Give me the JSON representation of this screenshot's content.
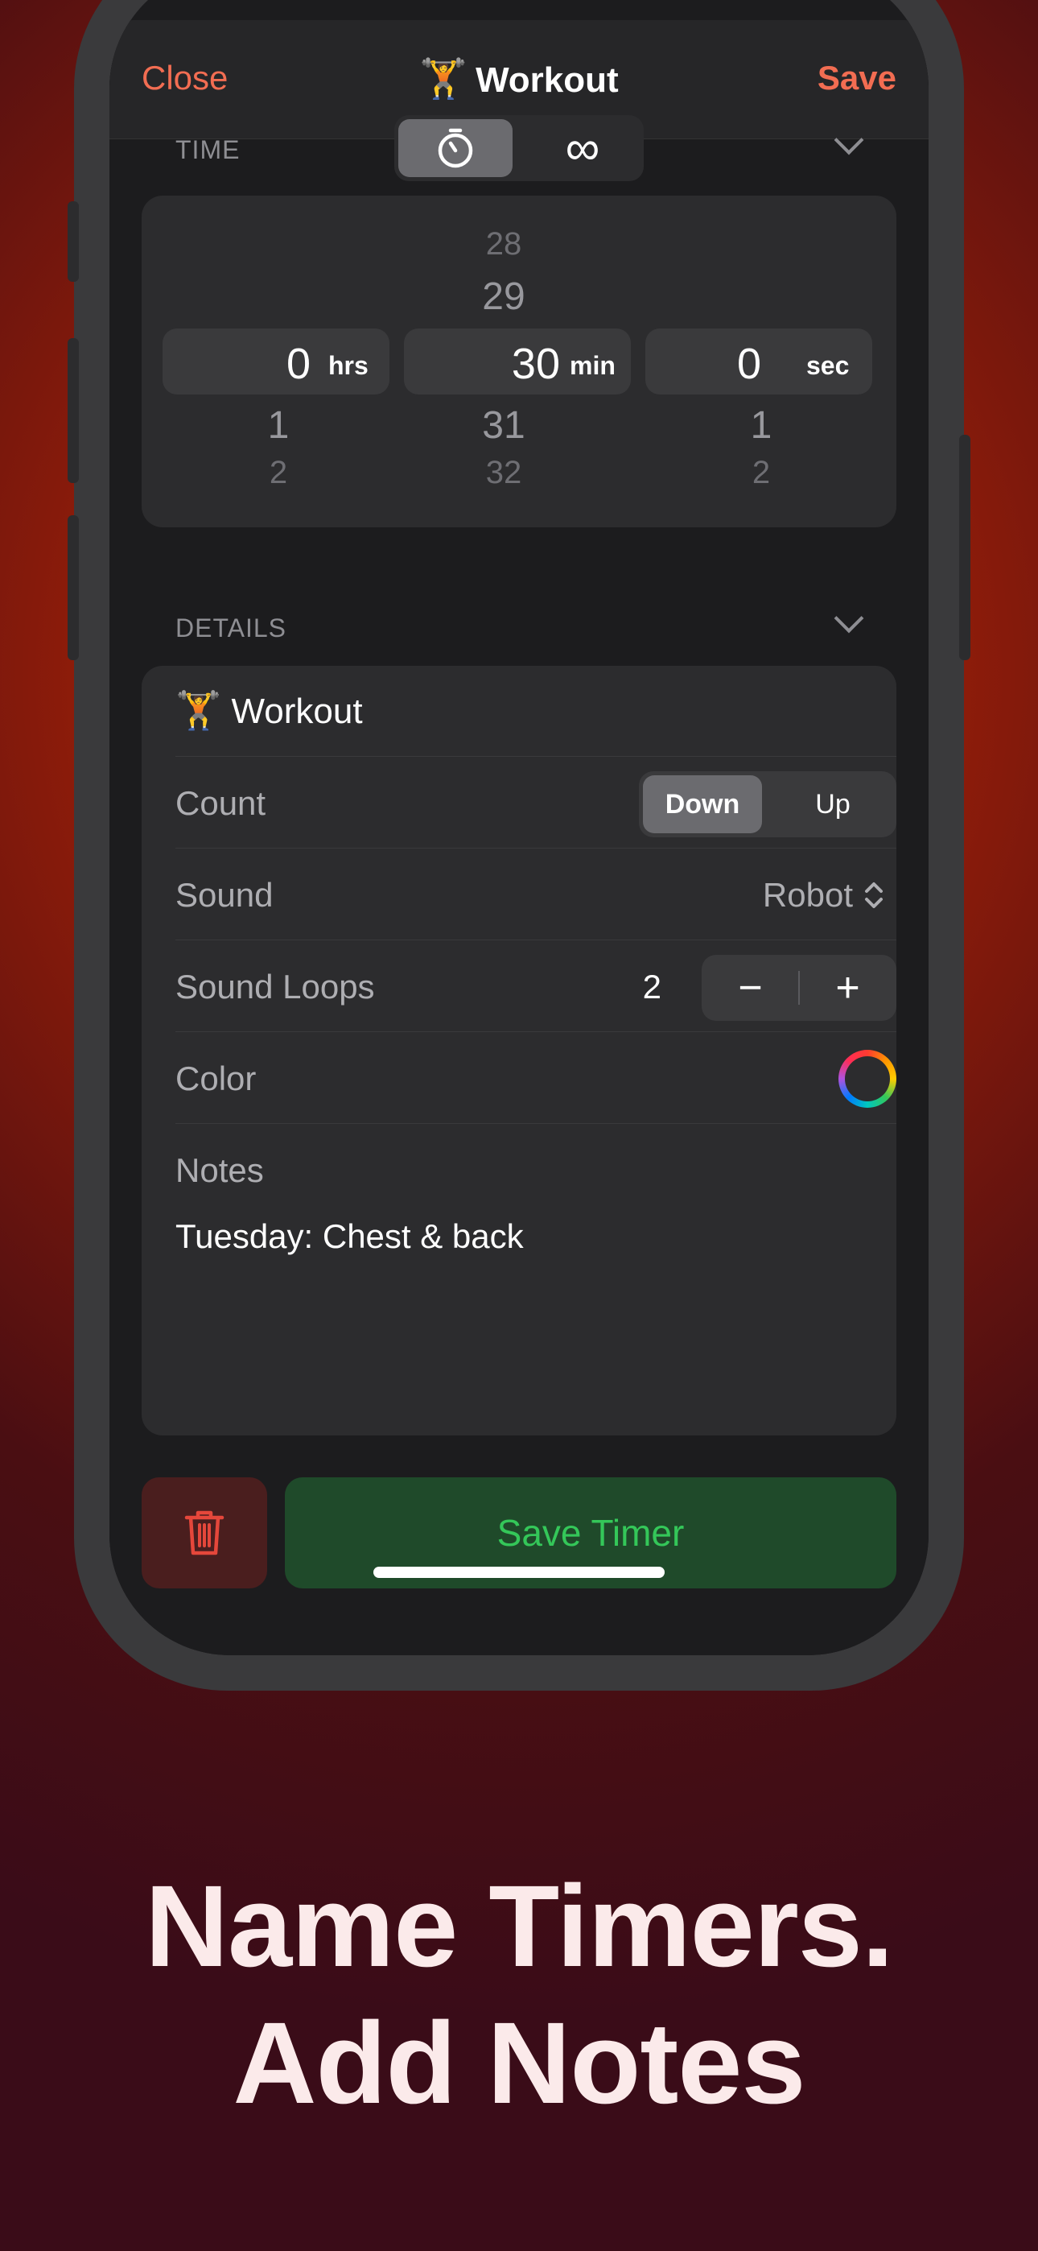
{
  "nav": {
    "close": "Close",
    "title": "Workout",
    "title_emoji": "🏋️",
    "save": "Save"
  },
  "time": {
    "section_label": "TIME",
    "mode_icons": [
      "stopwatch-icon",
      "infinity-icon"
    ],
    "infinity_glyph": "∞",
    "selected_mode": "stopwatch",
    "hours": {
      "above2": "",
      "above1": "",
      "value": "0",
      "unit": "hrs",
      "below1": "1",
      "below2": "2"
    },
    "minutes": {
      "above2": "28",
      "above1": "29",
      "value": "30",
      "unit": "min",
      "below1": "31",
      "below2": "32"
    },
    "seconds": {
      "above2": "",
      "above1": "",
      "value": "0",
      "unit": "sec",
      "below1": "1",
      "below2": "2"
    }
  },
  "details": {
    "section_label": "DETAILS",
    "name_emoji": "🏋️",
    "name": "Workout",
    "count": {
      "label": "Count",
      "options": [
        "Down",
        "Up"
      ],
      "selected": "Down"
    },
    "sound": {
      "label": "Sound",
      "value": "Robot"
    },
    "sound_loops": {
      "label": "Sound Loops",
      "value": "2",
      "minus": "−",
      "plus": "+"
    },
    "color": {
      "label": "Color"
    },
    "notes": {
      "label": "Notes",
      "value": "Tuesday: Chest & back"
    }
  },
  "footer": {
    "save_timer": "Save Timer"
  },
  "headline": {
    "line1": "Name Timers.",
    "line2": "Add Notes"
  },
  "colors": {
    "accent": "#f26d52",
    "green": "#34c759",
    "delete_red": "#e5473b"
  }
}
